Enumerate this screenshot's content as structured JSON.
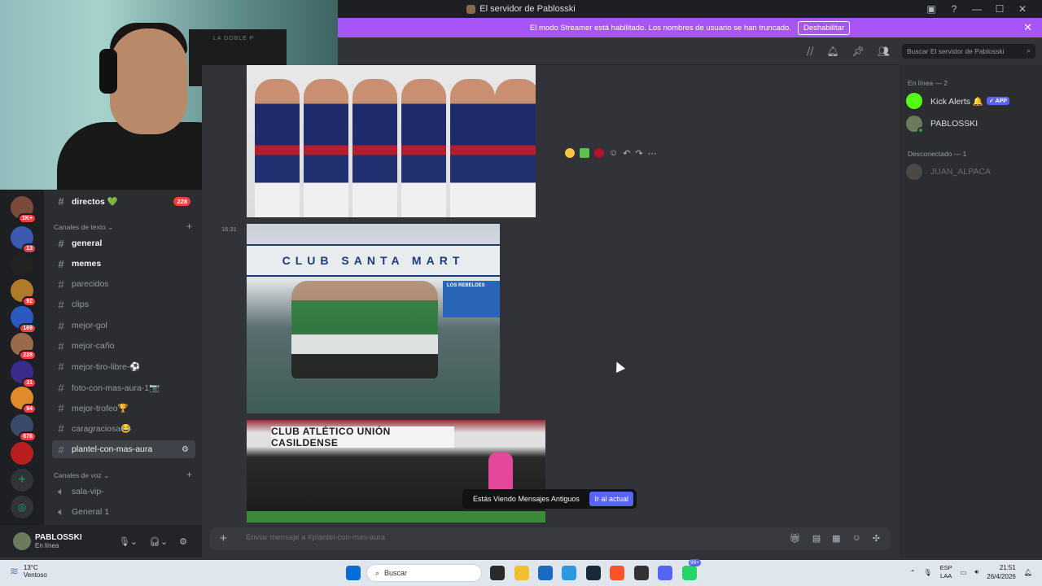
{
  "window": {
    "title": "El servidor de Pablosski",
    "controls": [
      "minimize-icon",
      "maximize-icon",
      "close-icon"
    ]
  },
  "streamer_bar": {
    "text": "El modo Streamer está habilitado. Los nombres de usuario se han truncado.",
    "button": "Deshabilitar",
    "color": "#a855f7"
  },
  "webcam": {
    "flag_text": "LA DOBLE P"
  },
  "server_rail": {
    "servers": [
      {
        "icon": "server-avatar-1",
        "badge": "1K+"
      },
      {
        "icon": "server-avatar-2",
        "badge": "13"
      },
      {
        "icon": "server-avatar-3",
        "badge": ""
      },
      {
        "icon": "server-avatar-4",
        "badge": "92"
      },
      {
        "icon": "server-avatar-5",
        "badge": "169"
      },
      {
        "icon": "server-avatar-6",
        "badge": "228"
      },
      {
        "icon": "server-avatar-7",
        "badge": "31"
      },
      {
        "icon": "server-avatar-8",
        "badge": "94"
      },
      {
        "icon": "server-avatar-9",
        "badge": "676"
      },
      {
        "icon": "server-avatar-10",
        "badge": ""
      }
    ]
  },
  "channels": {
    "top_channel": {
      "name": "directos 💚",
      "badge": "228"
    },
    "text_category": "Canales de texto",
    "text_channels": [
      {
        "name": "general",
        "unread": true
      },
      {
        "name": "memes",
        "unread": true
      },
      {
        "name": "parecidos",
        "unread": false
      },
      {
        "name": "clips",
        "unread": false
      },
      {
        "name": "mejor-gol",
        "unread": false
      },
      {
        "name": "mejor-caño",
        "unread": false
      },
      {
        "name": "mejor-tiro-libre-⚽",
        "unread": false
      },
      {
        "name": "foto-con-mas-aura-1📷",
        "unread": false
      },
      {
        "name": "mejor-trofeo🏆",
        "unread": false
      },
      {
        "name": "caragraciosa😂",
        "unread": false
      },
      {
        "name": "plantel-con-mas-aura",
        "unread": false,
        "active": true
      }
    ],
    "voice_category": "Canales de voz",
    "voice_channels": [
      {
        "name": "sala-vip-"
      },
      {
        "name": "General 1"
      }
    ]
  },
  "user_panel": {
    "name": "PABLOSSKI",
    "status": "En línea"
  },
  "header": {
    "icons": [
      "threads-icon",
      "bell-icon",
      "pin-icon",
      "members-icon"
    ]
  },
  "search": {
    "placeholder": "Buscar El servidor de Pablosski"
  },
  "messages": {
    "timestamp": "16:31",
    "image2_banner": "CLUB SANTA MART",
    "image2_sign": "LOS REBELDES",
    "image3_title": "CLUB ATLÉTICO UNIÓN CASILDENSE"
  },
  "old_messages_bar": {
    "text": "Estás Viendo Mensajes Antiguos",
    "button": "Ir al actual"
  },
  "composer": {
    "placeholder": "Enviar mensaje a #plantel-con-mas-aura"
  },
  "member_list": {
    "online_header": "En línea — 2",
    "online": [
      {
        "name": "Kick Alerts 🔔",
        "tag": "✓ APP",
        "avatar_color": "#53fc18"
      },
      {
        "name": "PABLOSSKI",
        "tag": "",
        "avatar_color": "#6b7b5b"
      }
    ],
    "offline_header": "Desconectado — 1",
    "offline": [
      {
        "name": "JUAN_ALPACA",
        "avatar_color": "#8a7a6a"
      }
    ]
  },
  "taskbar": {
    "weather_temp": "13°C",
    "weather_desc": "Ventoso",
    "search_label": "Buscar",
    "lang_top": "ESP",
    "lang_bottom": "LAA",
    "time": "21:51",
    "date": "26/4/2026",
    "discord_badge": "99+"
  }
}
